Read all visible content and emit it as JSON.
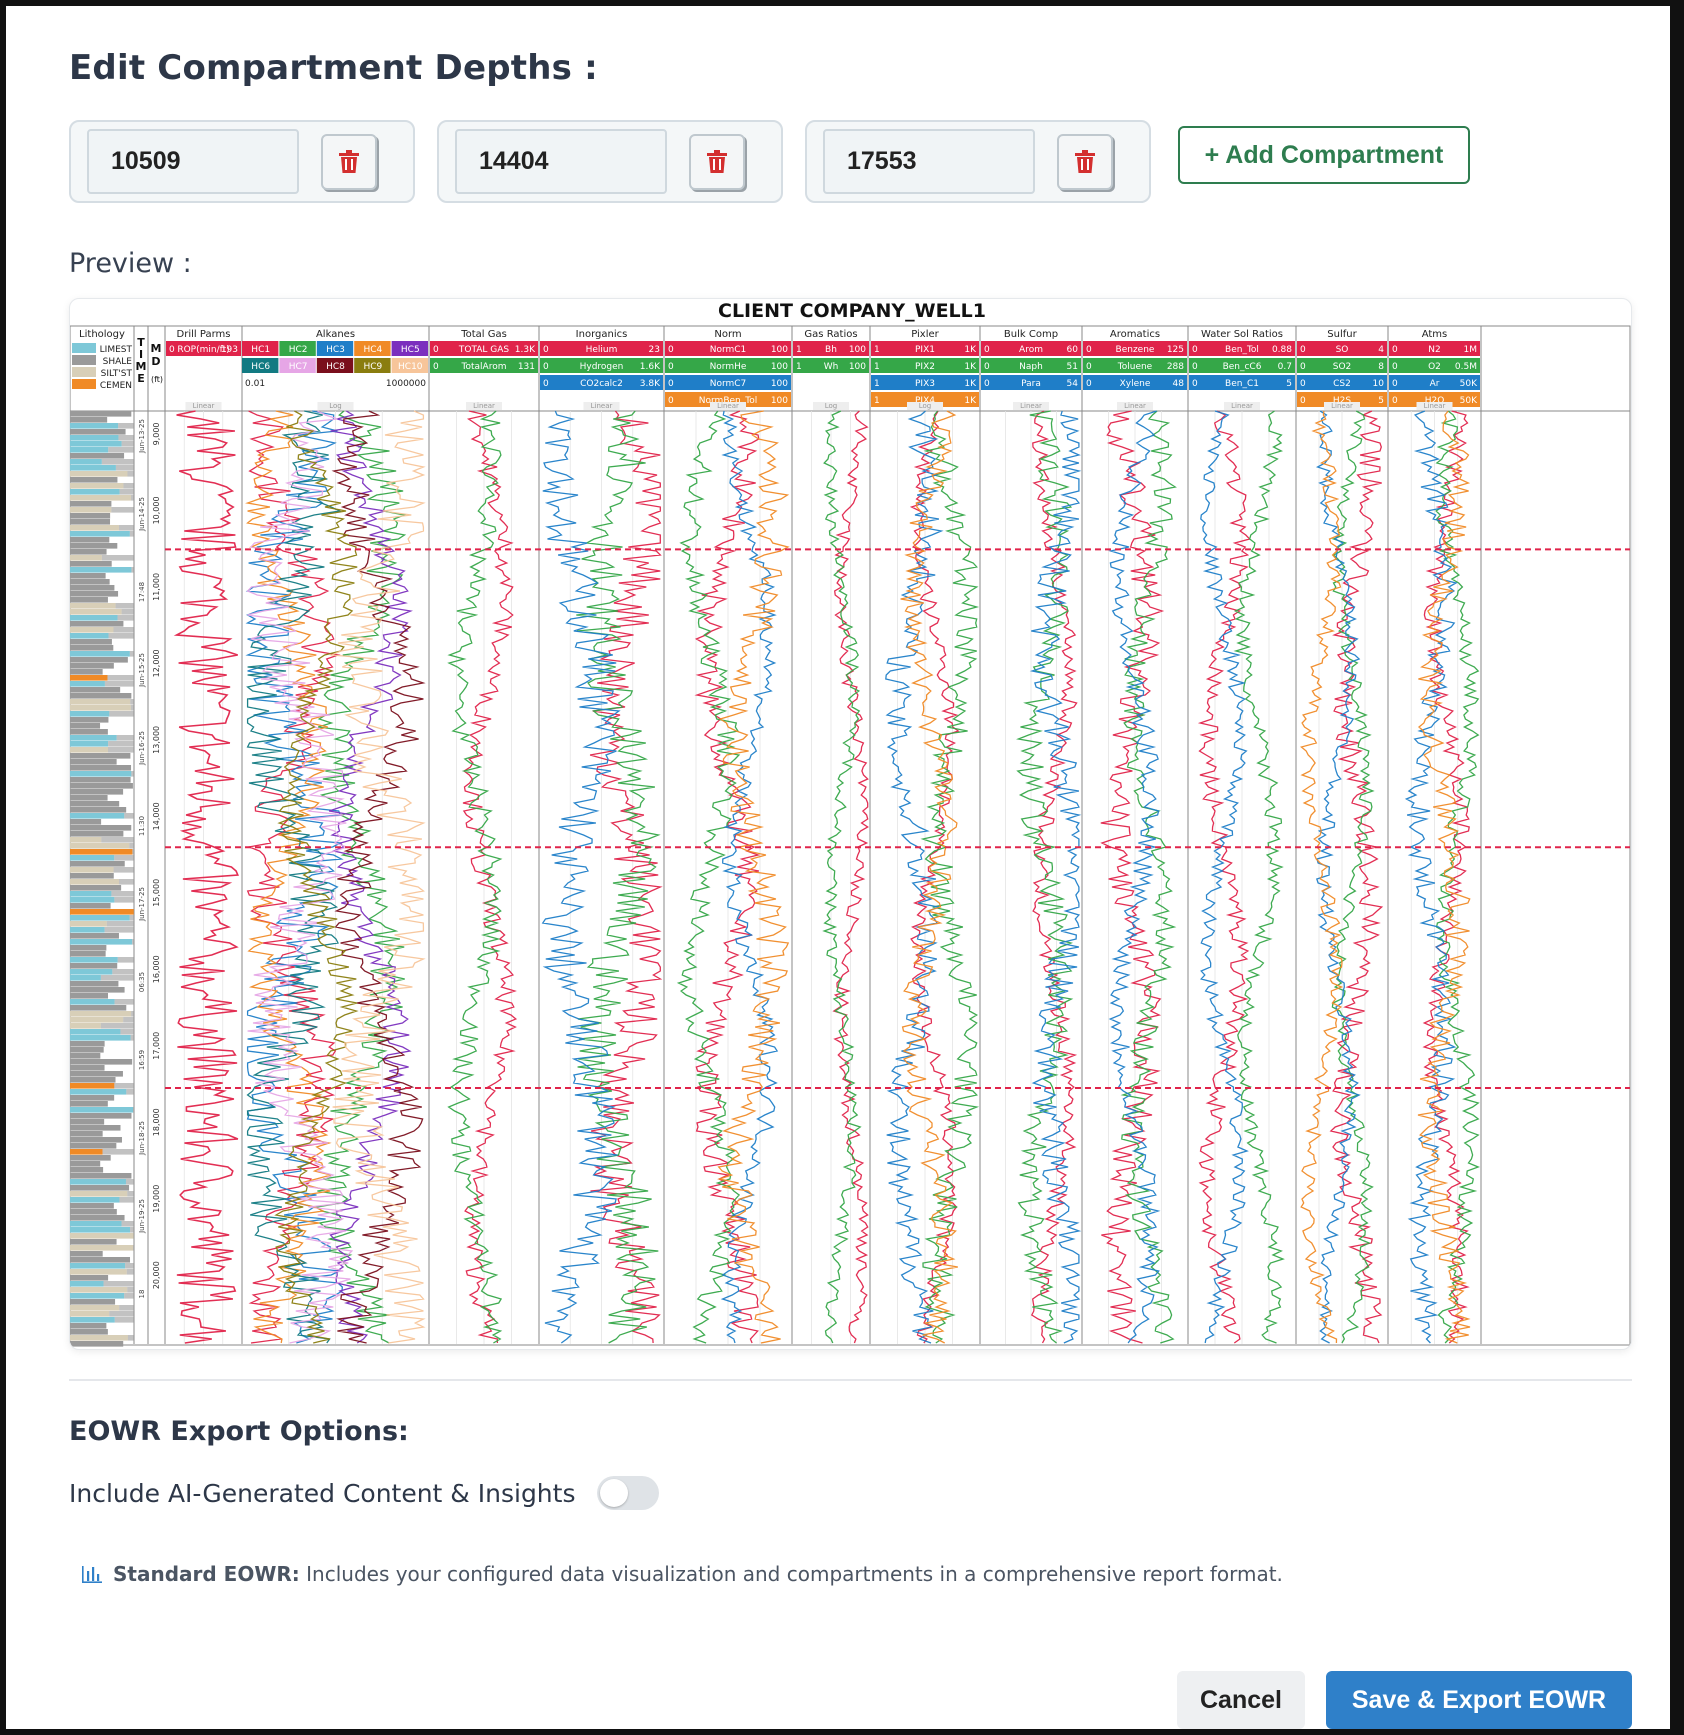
{
  "title": "Edit Compartment Depths :",
  "compartments": [
    {
      "depth": "10509"
    },
    {
      "depth": "14404"
    },
    {
      "depth": "17553"
    }
  ],
  "add_button_label": "+ Add Compartment",
  "preview_label": "Preview :",
  "chart_data": {
    "type": "line",
    "title": "CLIENT COMPANY_WELL1",
    "depth_axis": {
      "label": "MD (ft)",
      "ticks": [
        "9,000",
        "10,000",
        "11,000",
        "12,000",
        "13,000",
        "14,000",
        "15,000",
        "16,000",
        "17,000",
        "18,000",
        "19,000",
        "20,000"
      ],
      "ylim": [
        8700,
        20900
      ]
    },
    "time_labels": [
      "Jun-13-25",
      "Jun-14-25",
      "17:48",
      "Jun-15-25",
      "Jun-16-25",
      "11:30",
      "Jun-17-25",
      "06:35",
      "16:59",
      "Jun-18-25",
      "Jun-19-25",
      "18"
    ],
    "compartment_depths": [
      10509,
      14404,
      17553
    ],
    "lithology": {
      "header": "Lithology",
      "legend": [
        "LIMEST",
        "SHALE",
        "SILT'ST",
        "CEMEN"
      ],
      "colors": [
        "#7ec8d8",
        "#9a9a9a",
        "#d8cfb8",
        "#f08a26"
      ]
    },
    "time_header": "TIME",
    "md_header": "MD",
    "md_unit": "(ft)",
    "tracks": [
      {
        "name": "Drill Parms",
        "scale": "Linear",
        "curves": [
          {
            "label": "ROP(min/ft)",
            "min": "0",
            "max": "193",
            "color": "#e0234a"
          }
        ]
      },
      {
        "name": "Alkanes",
        "scale": "Log",
        "range_min": "0.01",
        "range_max": "1000000",
        "curves": [
          {
            "label": "HC1",
            "color": "#e0234a"
          },
          {
            "label": "HC2",
            "color": "#35a748"
          },
          {
            "label": "HC3",
            "color": "#1f7ec8"
          },
          {
            "label": "HC4",
            "color": "#f08a26"
          },
          {
            "label": "HC5",
            "color": "#7b2fbe"
          },
          {
            "label": "HC6",
            "color": "#127a82"
          },
          {
            "label": "HC7",
            "color": "#e6a6e6"
          },
          {
            "label": "HC8",
            "color": "#7a0f1c"
          },
          {
            "label": "HC9",
            "color": "#8a7d0f"
          },
          {
            "label": "HC10",
            "color": "#f7c59a"
          }
        ]
      },
      {
        "name": "Total Gas",
        "scale": "Linear",
        "curves": [
          {
            "label": "TOTAL GAS",
            "min": "0",
            "max": "1.3K",
            "color": "#e0234a"
          },
          {
            "label": "TotalArom",
            "min": "0",
            "max": "131",
            "color": "#35a748"
          }
        ]
      },
      {
        "name": "Inorganics",
        "scale": "Linear",
        "curves": [
          {
            "label": "Helium",
            "min": "0",
            "max": "23",
            "color": "#e0234a"
          },
          {
            "label": "Hydrogen",
            "min": "0",
            "max": "1.6K",
            "color": "#35a748"
          },
          {
            "label": "CO2calc2",
            "min": "0",
            "max": "3.8K",
            "color": "#1f7ec8"
          }
        ]
      },
      {
        "name": "Norm",
        "scale": "Linear",
        "curves": [
          {
            "label": "NormC1",
            "min": "0",
            "max": "100",
            "color": "#e0234a"
          },
          {
            "label": "NormHe",
            "min": "0",
            "max": "100",
            "color": "#35a748"
          },
          {
            "label": "NormC7",
            "min": "0",
            "max": "100",
            "color": "#1f7ec8"
          },
          {
            "label": "NormBen_Tol",
            "min": "0",
            "max": "100",
            "color": "#f08a26"
          }
        ]
      },
      {
        "name": "Gas Ratios",
        "scale": "Log",
        "curves": [
          {
            "label": "Bh",
            "min": "1",
            "max": "100",
            "color": "#e0234a"
          },
          {
            "label": "Wh",
            "min": "1",
            "max": "100",
            "color": "#35a748"
          }
        ]
      },
      {
        "name": "Pixler",
        "scale": "Log",
        "curves": [
          {
            "label": "PIX1",
            "min": "1",
            "max": "1K",
            "color": "#e0234a"
          },
          {
            "label": "PIX2",
            "min": "1",
            "max": "1K",
            "color": "#35a748"
          },
          {
            "label": "PIX3",
            "min": "1",
            "max": "1K",
            "color": "#1f7ec8"
          },
          {
            "label": "PIX4",
            "min": "1",
            "max": "1K",
            "color": "#f08a26"
          }
        ]
      },
      {
        "name": "Bulk Comp",
        "scale": "Linear",
        "curves": [
          {
            "label": "Arom",
            "min": "0",
            "max": "60",
            "color": "#e0234a"
          },
          {
            "label": "Naph",
            "min": "0",
            "max": "51",
            "color": "#35a748"
          },
          {
            "label": "Para",
            "min": "0",
            "max": "54",
            "color": "#1f7ec8"
          }
        ]
      },
      {
        "name": "Aromatics",
        "scale": "Linear",
        "curves": [
          {
            "label": "Benzene",
            "min": "0",
            "max": "125",
            "color": "#e0234a"
          },
          {
            "label": "Toluene",
            "min": "0",
            "max": "288",
            "color": "#35a748"
          },
          {
            "label": "Xylene",
            "min": "0",
            "max": "48",
            "color": "#1f7ec8"
          }
        ]
      },
      {
        "name": "Water Sol Ratios",
        "scale": "Linear",
        "curves": [
          {
            "label": "Ben_Tol",
            "min": "0",
            "max": "0.88",
            "color": "#e0234a"
          },
          {
            "label": "Ben_cC6",
            "min": "0",
            "max": "0.7",
            "color": "#35a748"
          },
          {
            "label": "Ben_C1",
            "min": "0",
            "max": "5",
            "color": "#1f7ec8"
          }
        ]
      },
      {
        "name": "Sulfur",
        "scale": "Linear",
        "curves": [
          {
            "label": "SO",
            "min": "0",
            "max": "4",
            "color": "#e0234a"
          },
          {
            "label": "SO2",
            "min": "0",
            "max": "8",
            "color": "#35a748"
          },
          {
            "label": "CS2",
            "min": "0",
            "max": "10",
            "color": "#1f7ec8"
          },
          {
            "label": "H2S",
            "min": "0",
            "max": "5",
            "color": "#f08a26"
          }
        ]
      },
      {
        "name": "Atms",
        "scale": "Linear",
        "curves": [
          {
            "label": "N2",
            "min": "0",
            "max": "1M",
            "color": "#e0234a"
          },
          {
            "label": "O2",
            "min": "0",
            "max": "0.5M",
            "color": "#35a748"
          },
          {
            "label": "Ar",
            "min": "0",
            "max": "50K",
            "color": "#1f7ec8"
          },
          {
            "label": "H2O",
            "min": "0",
            "max": "50K",
            "color": "#f08a26"
          }
        ]
      }
    ]
  },
  "eowr": {
    "title": "EOWR Export Options:",
    "ai_label": "Include AI-Generated Content & Insights",
    "ai_enabled": false,
    "info_icon": "bar-chart-icon",
    "info_strong": "Standard EOWR:",
    "info_text": "Includes your configured data visualization and compartments in a comprehensive report format."
  },
  "buttons": {
    "cancel": "Cancel",
    "save": "Save & Export EOWR"
  },
  "colors": {
    "primary": "#2f80c9",
    "success": "#2e7d4f",
    "danger": "#d32f2f",
    "red": "#e0234a",
    "green": "#35a748",
    "blue": "#1f7ec8",
    "orange": "#f08a26"
  }
}
